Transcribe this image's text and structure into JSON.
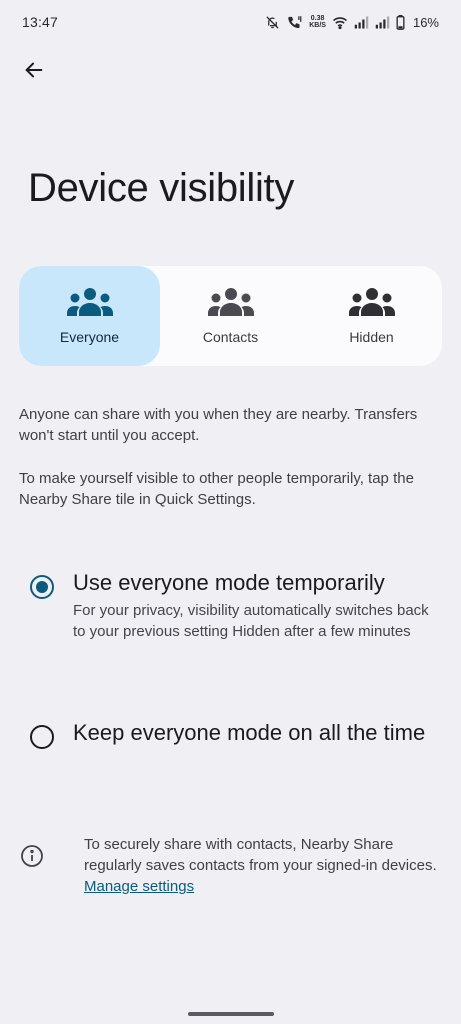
{
  "status_bar": {
    "time": "13:47",
    "net_speed_value": "0.38",
    "net_speed_unit": "KB/S",
    "battery": "16%"
  },
  "page": {
    "title": "Device visibility"
  },
  "segments": [
    {
      "label": "Everyone",
      "icon": "people-icon",
      "selected": true
    },
    {
      "label": "Contacts",
      "icon": "people-icon",
      "selected": false
    },
    {
      "label": "Hidden",
      "icon": "people-icon",
      "selected": false
    }
  ],
  "description": {
    "line1": "Anyone can share with you when they are nearby. Transfers won't start until you accept.",
    "line2": "To make yourself visible to other people temporarily, tap the Nearby Share tile in Quick Settings."
  },
  "options": [
    {
      "title": "Use everyone mode temporarily",
      "subtitle": "For your privacy, visibility automatically switches back to your previous setting Hidden after a few minutes",
      "checked": true
    },
    {
      "title": "Keep everyone mode on all the time",
      "checked": false
    }
  ],
  "info": {
    "text": "To securely share with contacts, Nearby Share regularly saves contacts from your signed-in devices.",
    "link": "Manage settings"
  },
  "colors": {
    "background": "#f0eff4",
    "accent": "#0b5b7f",
    "selected_segment": "#c9e7fb"
  }
}
